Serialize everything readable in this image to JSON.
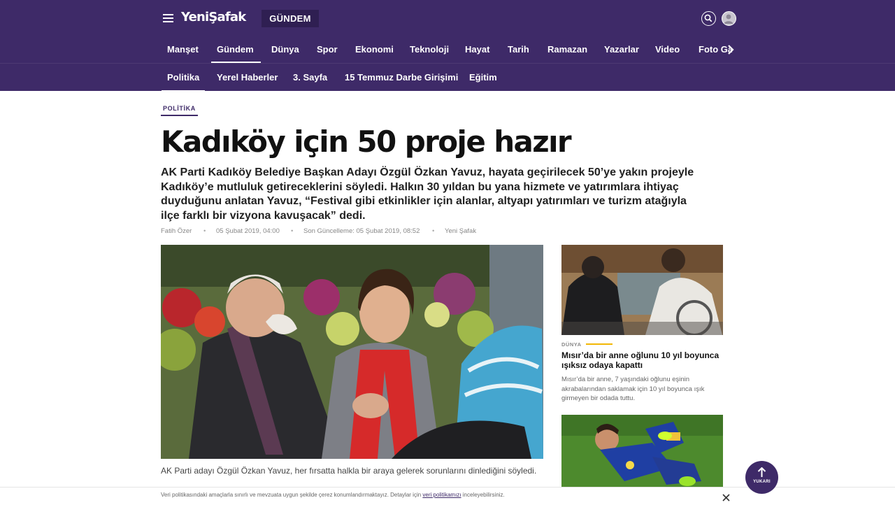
{
  "header": {
    "logo": "YeniŞafak",
    "section_badge": "GÜNDEM",
    "icons": {
      "menu": "hamburger-menu-icon",
      "search": "search-icon",
      "user": "user-avatar-icon",
      "next": "chevron-right-icon"
    }
  },
  "main_nav": {
    "items": [
      {
        "label": "Manşet"
      },
      {
        "label": "Gündem",
        "active": true
      },
      {
        "label": "Dünya"
      },
      {
        "label": "Spor"
      },
      {
        "label": "Ekonomi"
      },
      {
        "label": "Teknoloji"
      },
      {
        "label": "Hayat"
      },
      {
        "label": "Tarih"
      },
      {
        "label": "Ramazan"
      },
      {
        "label": "Yazarlar"
      },
      {
        "label": "Video"
      },
      {
        "label": "Foto Galeri"
      }
    ]
  },
  "sub_nav": {
    "items": [
      {
        "label": "Politika",
        "active": true
      },
      {
        "label": "Yerel Haberler"
      },
      {
        "label": "3. Sayfa"
      },
      {
        "label": "15 Temmuz Darbe Girişimi"
      },
      {
        "label": "Eğitim"
      }
    ]
  },
  "article": {
    "category": "POLİTİKA",
    "title": "Kadıköy için 50 proje hazır",
    "summary": "AK Parti Kadıköy Belediye Başkan Adayı Özgül Özkan Yavuz, hayata geçirilecek 50’ye yakın projeyle Kadıköy’e mutluluk getireceklerini söyledi. Halkın 30 yıldan bu yana hizmete ve yatırımlara ihtiyaç duyduğunu anlatan Yavuz, “Festival gibi etkinlikler için alanlar, altyapı yatırımları ve turizm atağıyla ilçe farklı bir vizyona kavuşacak” dedi.",
    "meta": {
      "author": "Fatih Özer",
      "published": "05 Şubat 2019, 04:00",
      "updated": "Son Güncelleme: 05 Şubat 2019, 08:52",
      "source": "Yeni Şafak"
    },
    "caption": "AK Parti adayı Özgül Özkan Yavuz, her fırsatta halkla bir araya gelerek sorunlarını dinlediğini söyledi."
  },
  "sidebar": {
    "cards": [
      {
        "category": "DÜNYA",
        "title": "Mısır’da bir anne oğlunu 10 yıl boyunca ışıksız odaya kapattı",
        "description": "Mısır’da bir anne, 7 yaşındaki oğlunu eşinin akrabalarından saklamak için 10 yıl boyunca ışık girmeyen bir odada tuttu.",
        "accent_color": "#f2b705"
      }
    ]
  },
  "cookie_notice": {
    "text": "Veri politikasındaki amaçlarla sınırlı ve mevzuata uygun şekilde çerez konumlandırmaktayız. Detaylar için ",
    "link": "veri politikamızı",
    "suffix": " inceleyebilirsiniz.",
    "close_icon": "close-icon"
  },
  "scroll_top": {
    "label": "YUKARI",
    "icon": "arrow-up-icon"
  },
  "colors": {
    "brand": "#3e2a68",
    "brand_dark": "#2f1f52",
    "accent": "#f2b705"
  }
}
